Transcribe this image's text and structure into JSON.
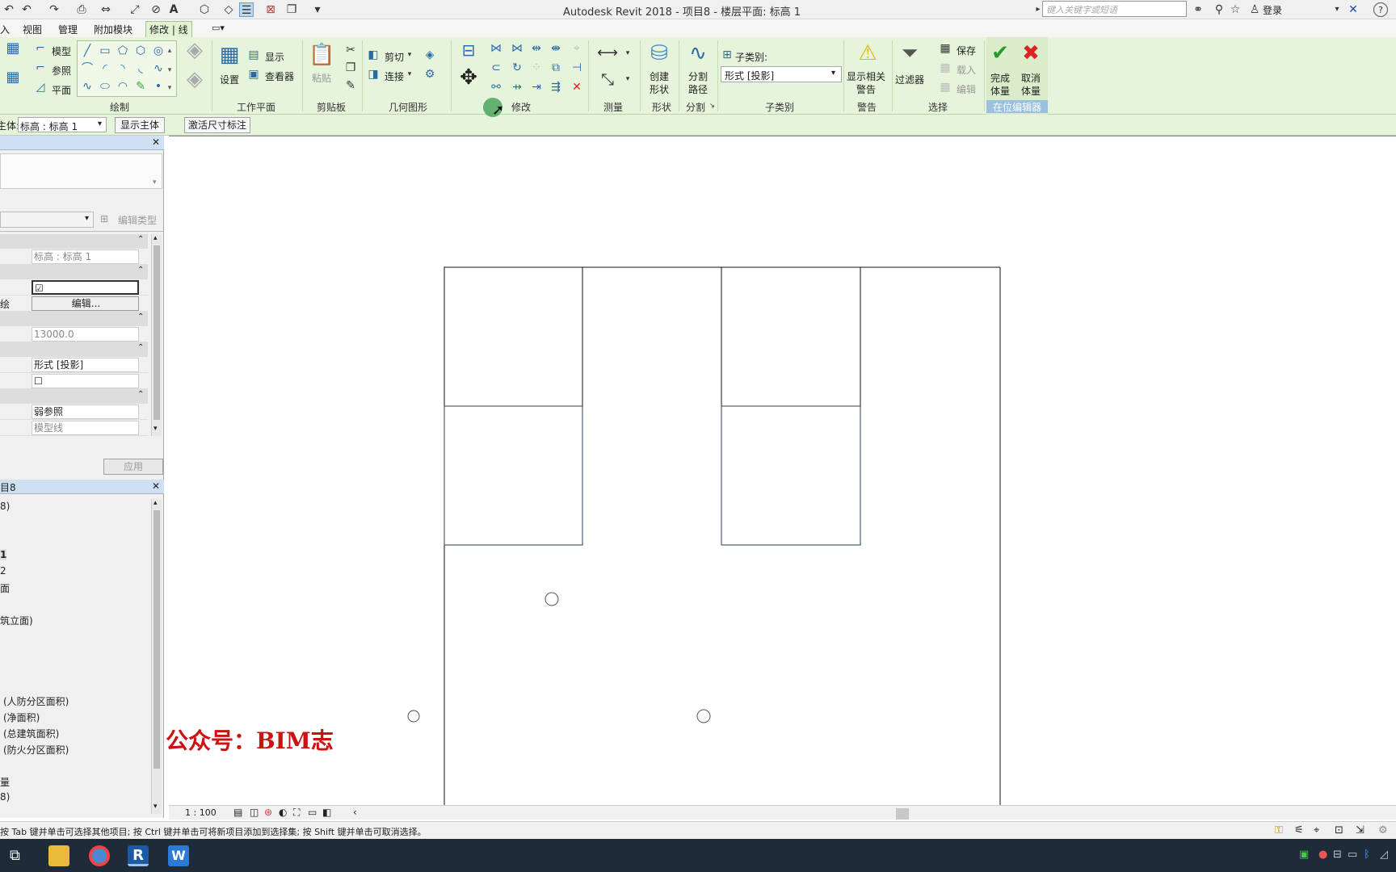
{
  "app": {
    "title": "Autodesk Revit 2018 -    项目8 - 楼层平面: 标高 1",
    "search_placeholder": "键入关键字或短语",
    "signin": "登录",
    "help": "?"
  },
  "menu": {
    "tabs": [
      "入",
      "视图",
      "管理",
      "附加模块",
      "修改 | 线"
    ],
    "extra": "▭▾"
  },
  "ribbon": {
    "draw": {
      "title": "绘制",
      "model": "模型",
      "ref": "参照",
      "plane": "平面"
    },
    "workplane": {
      "title": "工作平面",
      "set": "设置",
      "show": "显示",
      "viewer": "查看器"
    },
    "clipboard": {
      "title": "剪贴板",
      "paste": "粘贴"
    },
    "geometry": {
      "title": "几何图形",
      "cut": "剪切",
      "join": "连接"
    },
    "modify": {
      "title": "修改"
    },
    "measure": {
      "title": "测量"
    },
    "form": {
      "title": "形状",
      "create_line1": "创建",
      "create_line2": "形状"
    },
    "divide": {
      "title": "分割",
      "path_line1": "分割",
      "path_line2": "路径"
    },
    "subcategory": {
      "title": "子类别",
      "label": "子类别:",
      "value": "形式 [投影]"
    },
    "warning": {
      "title": "警告",
      "line1": "显示相关",
      "line2": "警告"
    },
    "selection": {
      "title": "选择",
      "filter": "过滤器",
      "save": "保存",
      "load": "载入",
      "edit": "编辑"
    },
    "inplace": {
      "title": "在位编辑器",
      "finish1": "完成",
      "finish2": "体量",
      "cancel1": "取消",
      "cancel2": "体量"
    }
  },
  "options": {
    "host_label": "主体:",
    "host_value": "标高 : 标高 1",
    "show_host": "显示主体",
    "activate_dim": "激活尺寸标注"
  },
  "properties": {
    "edit_type": "编辑类型",
    "rows": [
      {
        "label": "",
        "value": "标高 : 标高 1"
      },
      {
        "label": "",
        "value": "☑"
      },
      {
        "label": "绘",
        "value": "编辑..."
      },
      {
        "label": "",
        "value": "13000.0"
      },
      {
        "label": "",
        "value": "形式 [投影]"
      },
      {
        "label": "",
        "value": "☐"
      },
      {
        "label": "",
        "value": "弱参照"
      },
      {
        "label": "",
        "value": "模型线"
      }
    ],
    "apply": "应用"
  },
  "browser": {
    "title": "目8",
    "items": [
      "8)",
      "1",
      "2",
      "面",
      "筑立面)",
      "(人防分区面积)",
      "(净面积)",
      "(总建筑面积)",
      "(防火分区面积)",
      "量",
      "8)"
    ]
  },
  "viewbar": {
    "scale": "1 : 100"
  },
  "status": {
    "text": "按 Tab 键并单击可选择其他项目; 按 Ctrl 键并单击可将新项目添加到选择集; 按 Shift 键并单击可取消选择。"
  },
  "watermark": "公众号：BIM志",
  "colors": {
    "ribbon_bg": "#e7f4dc",
    "taskbar": "#1e2b38",
    "accent": "#2a6aa8",
    "watermark": "#cc1111"
  }
}
